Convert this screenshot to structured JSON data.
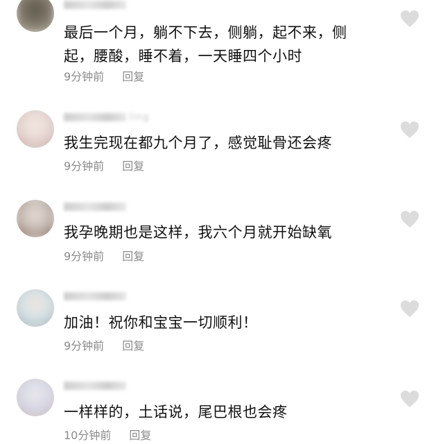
{
  "comments": [
    {
      "username_suffix": "",
      "text": "最后一个月，躺不下去，侧躺，起不来，侧起，腰酸，睡不着，一天睡四个小时",
      "time": "9分钟前",
      "reply": "回复",
      "avatar_colors": [
        "#7d7566",
        "#b3ad9a",
        "#5f5a4e"
      ]
    },
    {
      "username_suffix": "ling",
      "text": "我生完现在都九个月了，感觉耻骨还会疼",
      "time": "9分钟前",
      "reply": "回复",
      "avatar_colors": [
        "#e8d9d4",
        "#c9aaa4",
        "#f3e7e2"
      ]
    },
    {
      "username_suffix": "",
      "text": "我孕晚期也是这样，我六个月就开始缺氧",
      "time": "9分钟前",
      "reply": "回复",
      "avatar_colors": [
        "#c9bfb8",
        "#8a6f62",
        "#e6dcd6"
      ]
    },
    {
      "username_suffix": "",
      "text": "加油！祝你和宝宝一切顺利！",
      "time": "9分钟前",
      "reply": "回复",
      "avatar_colors": [
        "#d7e3e6",
        "#9fb6bd",
        "#efe4dc"
      ]
    },
    {
      "username_suffix": "",
      "text": "一样样的，土话说，尾巴根也会疼",
      "time": "10分钟前",
      "reply": "回复",
      "avatar_colors": [
        "#d9dbe8",
        "#c7b7bd",
        "#ece7ea"
      ]
    }
  ]
}
